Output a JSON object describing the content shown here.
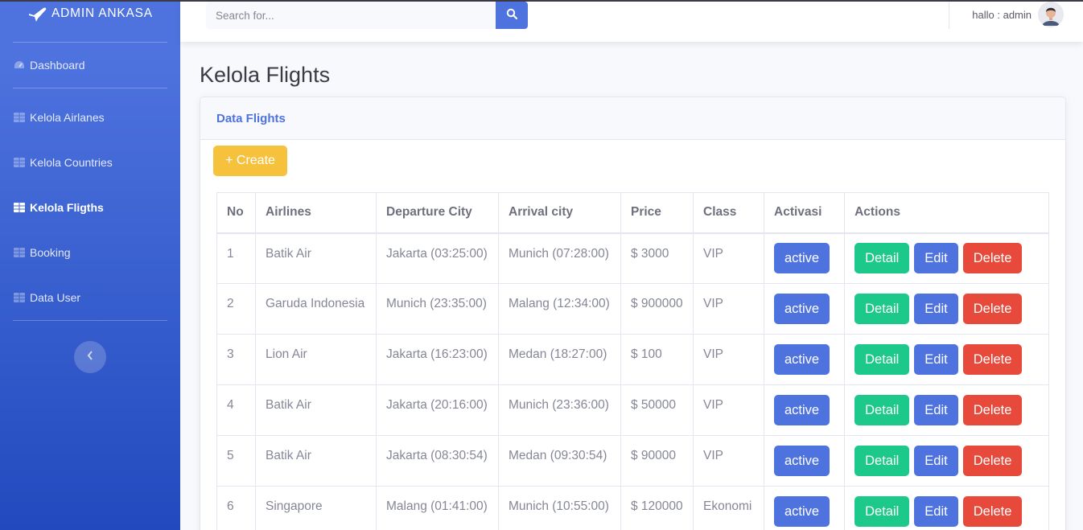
{
  "sidebar": {
    "brand": "ADMIN ANKASA",
    "items": [
      {
        "label": "Dashboard",
        "icon": "tachometer-icon"
      },
      {
        "label": "Kelola Airlanes",
        "icon": "table-icon"
      },
      {
        "label": "Kelola Countries",
        "icon": "table-icon"
      },
      {
        "label": "Kelola Fligths",
        "icon": "table-icon",
        "active": true
      },
      {
        "label": "Booking",
        "icon": "table-icon"
      },
      {
        "label": "Data User",
        "icon": "table-icon"
      }
    ]
  },
  "topbar": {
    "search_placeholder": "Search for...",
    "user_label": "hallo : admin"
  },
  "page": {
    "title": "Kelola Flights",
    "card_title": "Data Flights",
    "create_label": "+ Create"
  },
  "table": {
    "headers": [
      "No",
      "Airlines",
      "Departure City",
      "Arrival city",
      "Price",
      "Class",
      "Activasi",
      "Actions"
    ],
    "rows": [
      {
        "no": "1",
        "airline": "Batik Air",
        "departure": "Jakarta (03:25:00)",
        "arrival": "Munich (07:28:00)",
        "price": "$ 3000",
        "class": "VIP",
        "status": "active"
      },
      {
        "no": "2",
        "airline": "Garuda Indonesia",
        "departure": "Munich (23:35:00)",
        "arrival": "Malang (12:34:00)",
        "price": "$ 900000",
        "class": "VIP",
        "status": "active"
      },
      {
        "no": "3",
        "airline": "Lion Air",
        "departure": "Jakarta (16:23:00)",
        "arrival": "Medan (18:27:00)",
        "price": "$ 100",
        "class": "VIP",
        "status": "active"
      },
      {
        "no": "4",
        "airline": "Batik Air",
        "departure": "Jakarta (20:16:00)",
        "arrival": "Munich (23:36:00)",
        "price": "$ 50000",
        "class": "VIP",
        "status": "active"
      },
      {
        "no": "5",
        "airline": "Batik Air",
        "departure": "Jakarta (08:30:54)",
        "arrival": "Medan (09:30:54)",
        "price": "$ 90000",
        "class": "VIP",
        "status": "active"
      },
      {
        "no": "6",
        "airline": "Singapore",
        "departure": "Malang (01:41:00)",
        "arrival": "Munich (10:55:00)",
        "price": "$ 120000",
        "class": "Ekonomi",
        "status": "active"
      }
    ],
    "actions": {
      "detail": "Detail",
      "edit": "Edit",
      "delete": "Delete"
    }
  },
  "colors": {
    "primary": "#4e73df",
    "success": "#1cc88a",
    "danger": "#e74a3b",
    "warning": "#f6c23e"
  }
}
